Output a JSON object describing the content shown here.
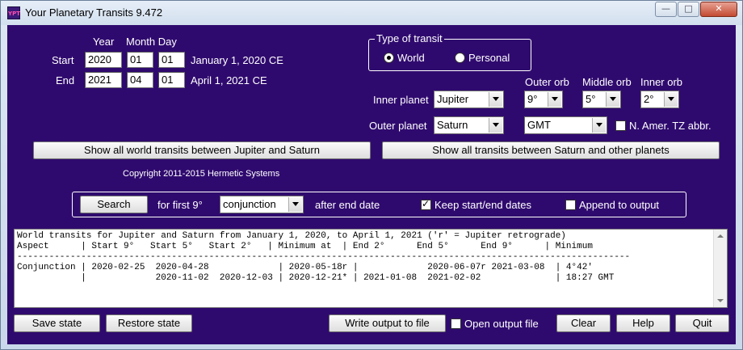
{
  "window": {
    "title": "Your Planetary Transits 9.472",
    "icon_text": "YPT",
    "minimize_glyph": "—",
    "maximize_glyph": "□",
    "close_glyph": "✕"
  },
  "dates": {
    "year_header": "Year",
    "month_day_header": "Month Day",
    "start_label": "Start",
    "start_year": "2020",
    "start_month": "01",
    "start_day": "01",
    "start_text": "January 1, 2020 CE",
    "end_label": "End",
    "end_year": "2021",
    "end_month": "04",
    "end_day": "01",
    "end_text": "April 1, 2021 CE"
  },
  "transit_type": {
    "title": "Type of transit",
    "world_label": "World",
    "personal_label": "Personal",
    "selected": "World"
  },
  "planets": {
    "inner_label": "Inner planet",
    "inner_value": "Jupiter",
    "outer_label": "Outer planet",
    "outer_value": "Saturn",
    "outer_orb_label": "Outer orb",
    "outer_orb_value": "9°",
    "middle_orb_label": "Middle orb",
    "middle_orb_value": "5°",
    "inner_orb_label": "Inner orb",
    "inner_orb_value": "2°",
    "timezone_value": "GMT",
    "tz_abbr_label": "N. Amer. TZ abbr.",
    "tz_abbr_checked": false
  },
  "show_buttons": {
    "world_transits": "Show all world transits between Jupiter and Saturn",
    "all_transits": "Show all transits between Saturn and other planets"
  },
  "copyright": "Copyright 2011-2015 Hermetic Systems",
  "search": {
    "button": "Search",
    "for_first": "for first 9°",
    "aspect_value": "conjunction",
    "after_end": "after end date",
    "keep_dates_label": "Keep start/end dates",
    "keep_dates_checked": true,
    "append_label": "Append to output",
    "append_checked": false
  },
  "output": {
    "lines": [
      "World transits for Jupiter and Saturn from January 1, 2020, to April 1, 2021 ('r' = Jupiter retrograde)",
      "Aspect      | Start 9°   Start 5°   Start 2°   | Minimum at  | End 2°      End 5°      End 9°      | Minimum",
      "-------------------------------------------------------------------------------------------------------------------",
      "Conjunction | 2020-02-25  2020-04-28             | 2020-05-18r |             2020-06-07r 2021-03-08  | 4°42'",
      "            |             2020-11-02  2020-12-03 | 2020-12-21* | 2021-01-08  2021-02-02              | 18:27 GMT"
    ]
  },
  "bottom": {
    "save_state": "Save state",
    "restore_state": "Restore state",
    "write_output": "Write output to file",
    "open_output_label": "Open output file",
    "open_output_checked": false,
    "clear": "Clear",
    "help": "Help",
    "quit": "Quit"
  },
  "colors": {
    "background": "#2f0a6e",
    "text": "#ffffff"
  }
}
